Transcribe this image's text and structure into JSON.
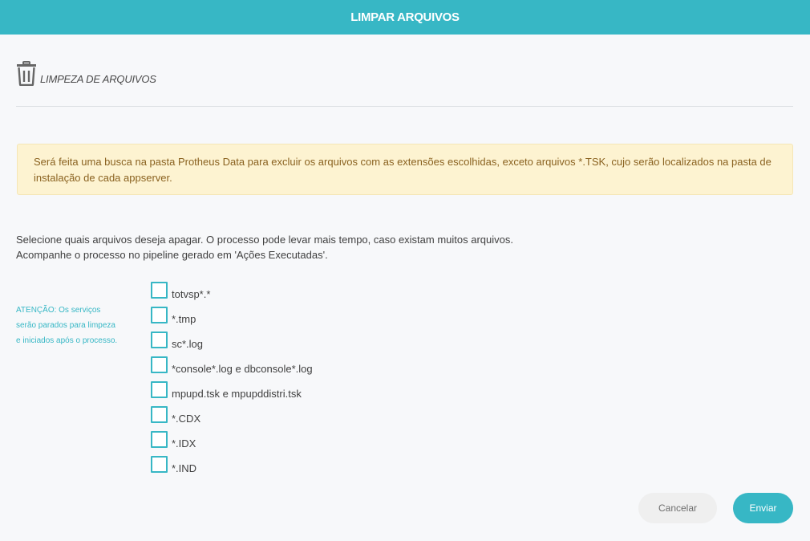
{
  "header": {
    "title": "LIMPAR ARQUIVOS"
  },
  "section": {
    "icon": "trash-icon",
    "title": "LIMPEZA DE ARQUIVOS"
  },
  "alert": {
    "text": "Será feita uma busca na pasta Protheus Data para excluir os arquivos com as extensões escolhidas, exceto arquivos *.TSK, cujo serão localizados na pasta de instalação de cada appserver."
  },
  "intro": {
    "line1": "Selecione quais arquivos deseja apagar. O processo pode levar mais tempo, caso existam muitos arquivos.",
    "line2": "Acompanhe o processo no pipeline gerado em 'Ações Executadas'."
  },
  "warning": {
    "line1": "ATENÇÃO: Os serviços",
    "line2": "serão parados para limpeza",
    "line3": "e iniciados após o processo."
  },
  "options": [
    {
      "label": "totvsp*.*",
      "checked": false
    },
    {
      "label": "*.tmp",
      "checked": false
    },
    {
      "label": "sc*.log",
      "checked": false
    },
    {
      "label": "*console*.log e dbconsole*.log",
      "checked": false
    },
    {
      "label": "mpupd.tsk e mpupddistri.tsk",
      "checked": false
    },
    {
      "label": "*.CDX",
      "checked": false
    },
    {
      "label": "*.IDX",
      "checked": false
    },
    {
      "label": "*.IND",
      "checked": false
    }
  ],
  "buttons": {
    "cancel": "Cancelar",
    "submit": "Enviar"
  },
  "colors": {
    "accent": "#37b7c5",
    "alert_bg": "#fdf3d1",
    "alert_text": "#8a6220"
  }
}
